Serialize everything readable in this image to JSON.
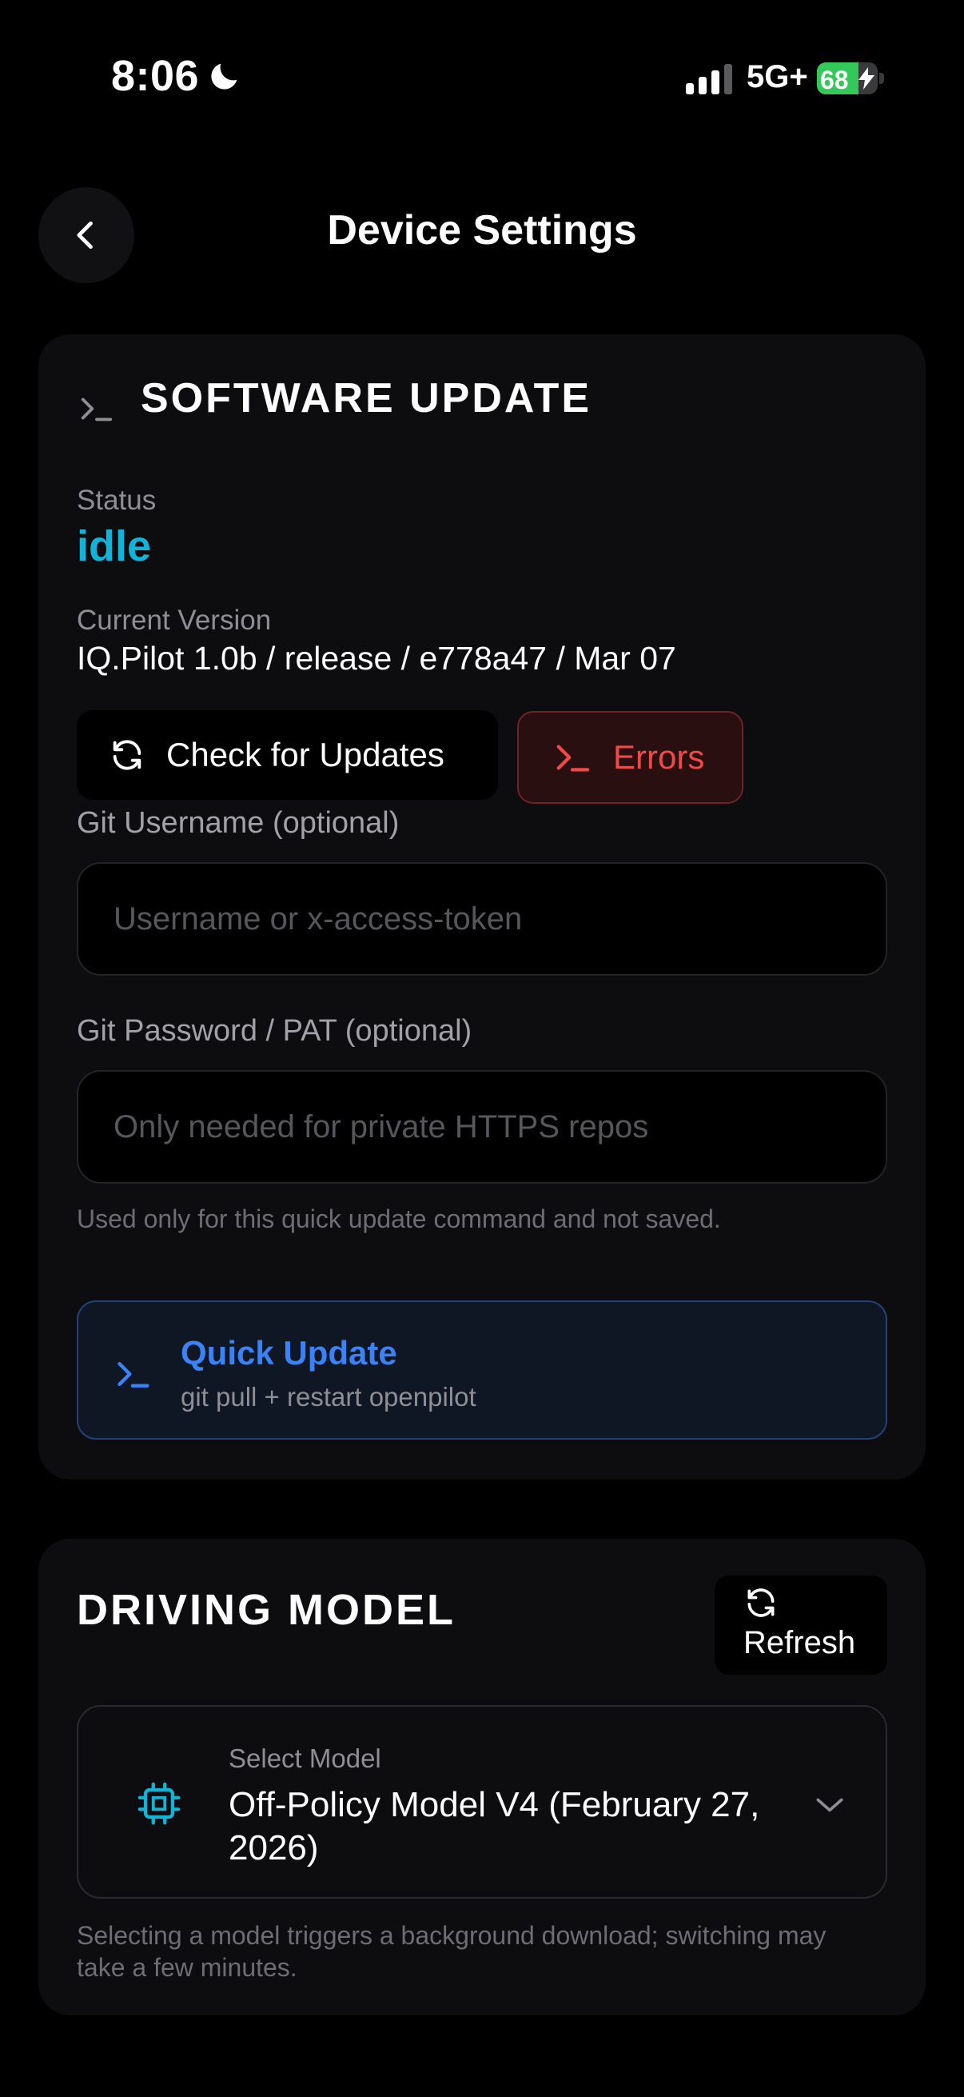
{
  "status_bar": {
    "time": "8:06",
    "network": "5G+",
    "battery": "68",
    "battery_level": 0.68,
    "icons": [
      "moon-icon",
      "signal-icon",
      "battery-icon",
      "bolt-icon"
    ]
  },
  "header": {
    "title": "Device Settings",
    "back_icon": "chevron-left-icon"
  },
  "software_update": {
    "section_icon": "terminal-icon",
    "title": "SOFTWARE UPDATE",
    "status_label": "Status",
    "status_value": "idle",
    "version_label": "Current Version",
    "version_value": "IQ.Pilot 1.0b / release / e778a47 / Mar 07",
    "check_button": "Check for Updates",
    "errors_button": "Errors",
    "git_username_label": "Git Username (optional)",
    "git_username_placeholder": "Username or x-access-token",
    "git_username_value": "",
    "git_password_label": "Git Password / PAT (optional)",
    "git_password_placeholder": "Only needed for private HTTPS repos",
    "git_password_value": "",
    "credentials_hint": "Used only for this quick update command and not saved.",
    "quick_update_title": "Quick Update",
    "quick_update_subtitle": "git pull + restart openpilot"
  },
  "driving_model": {
    "title": "DRIVING MODEL",
    "refresh_button": "Refresh",
    "select_label": "Select Model",
    "select_value": "Off-Policy Model V4 (February 27, 2026)",
    "hint": "Selecting a model triggers a background download; switching may take a few minutes."
  },
  "colors": {
    "background": "#000000",
    "card": "#0d0d0f",
    "status_idle": "#12b3d6",
    "error_red": "#ef4a4a",
    "accent_blue": "#3b82f6",
    "battery_green": "#34c759"
  }
}
